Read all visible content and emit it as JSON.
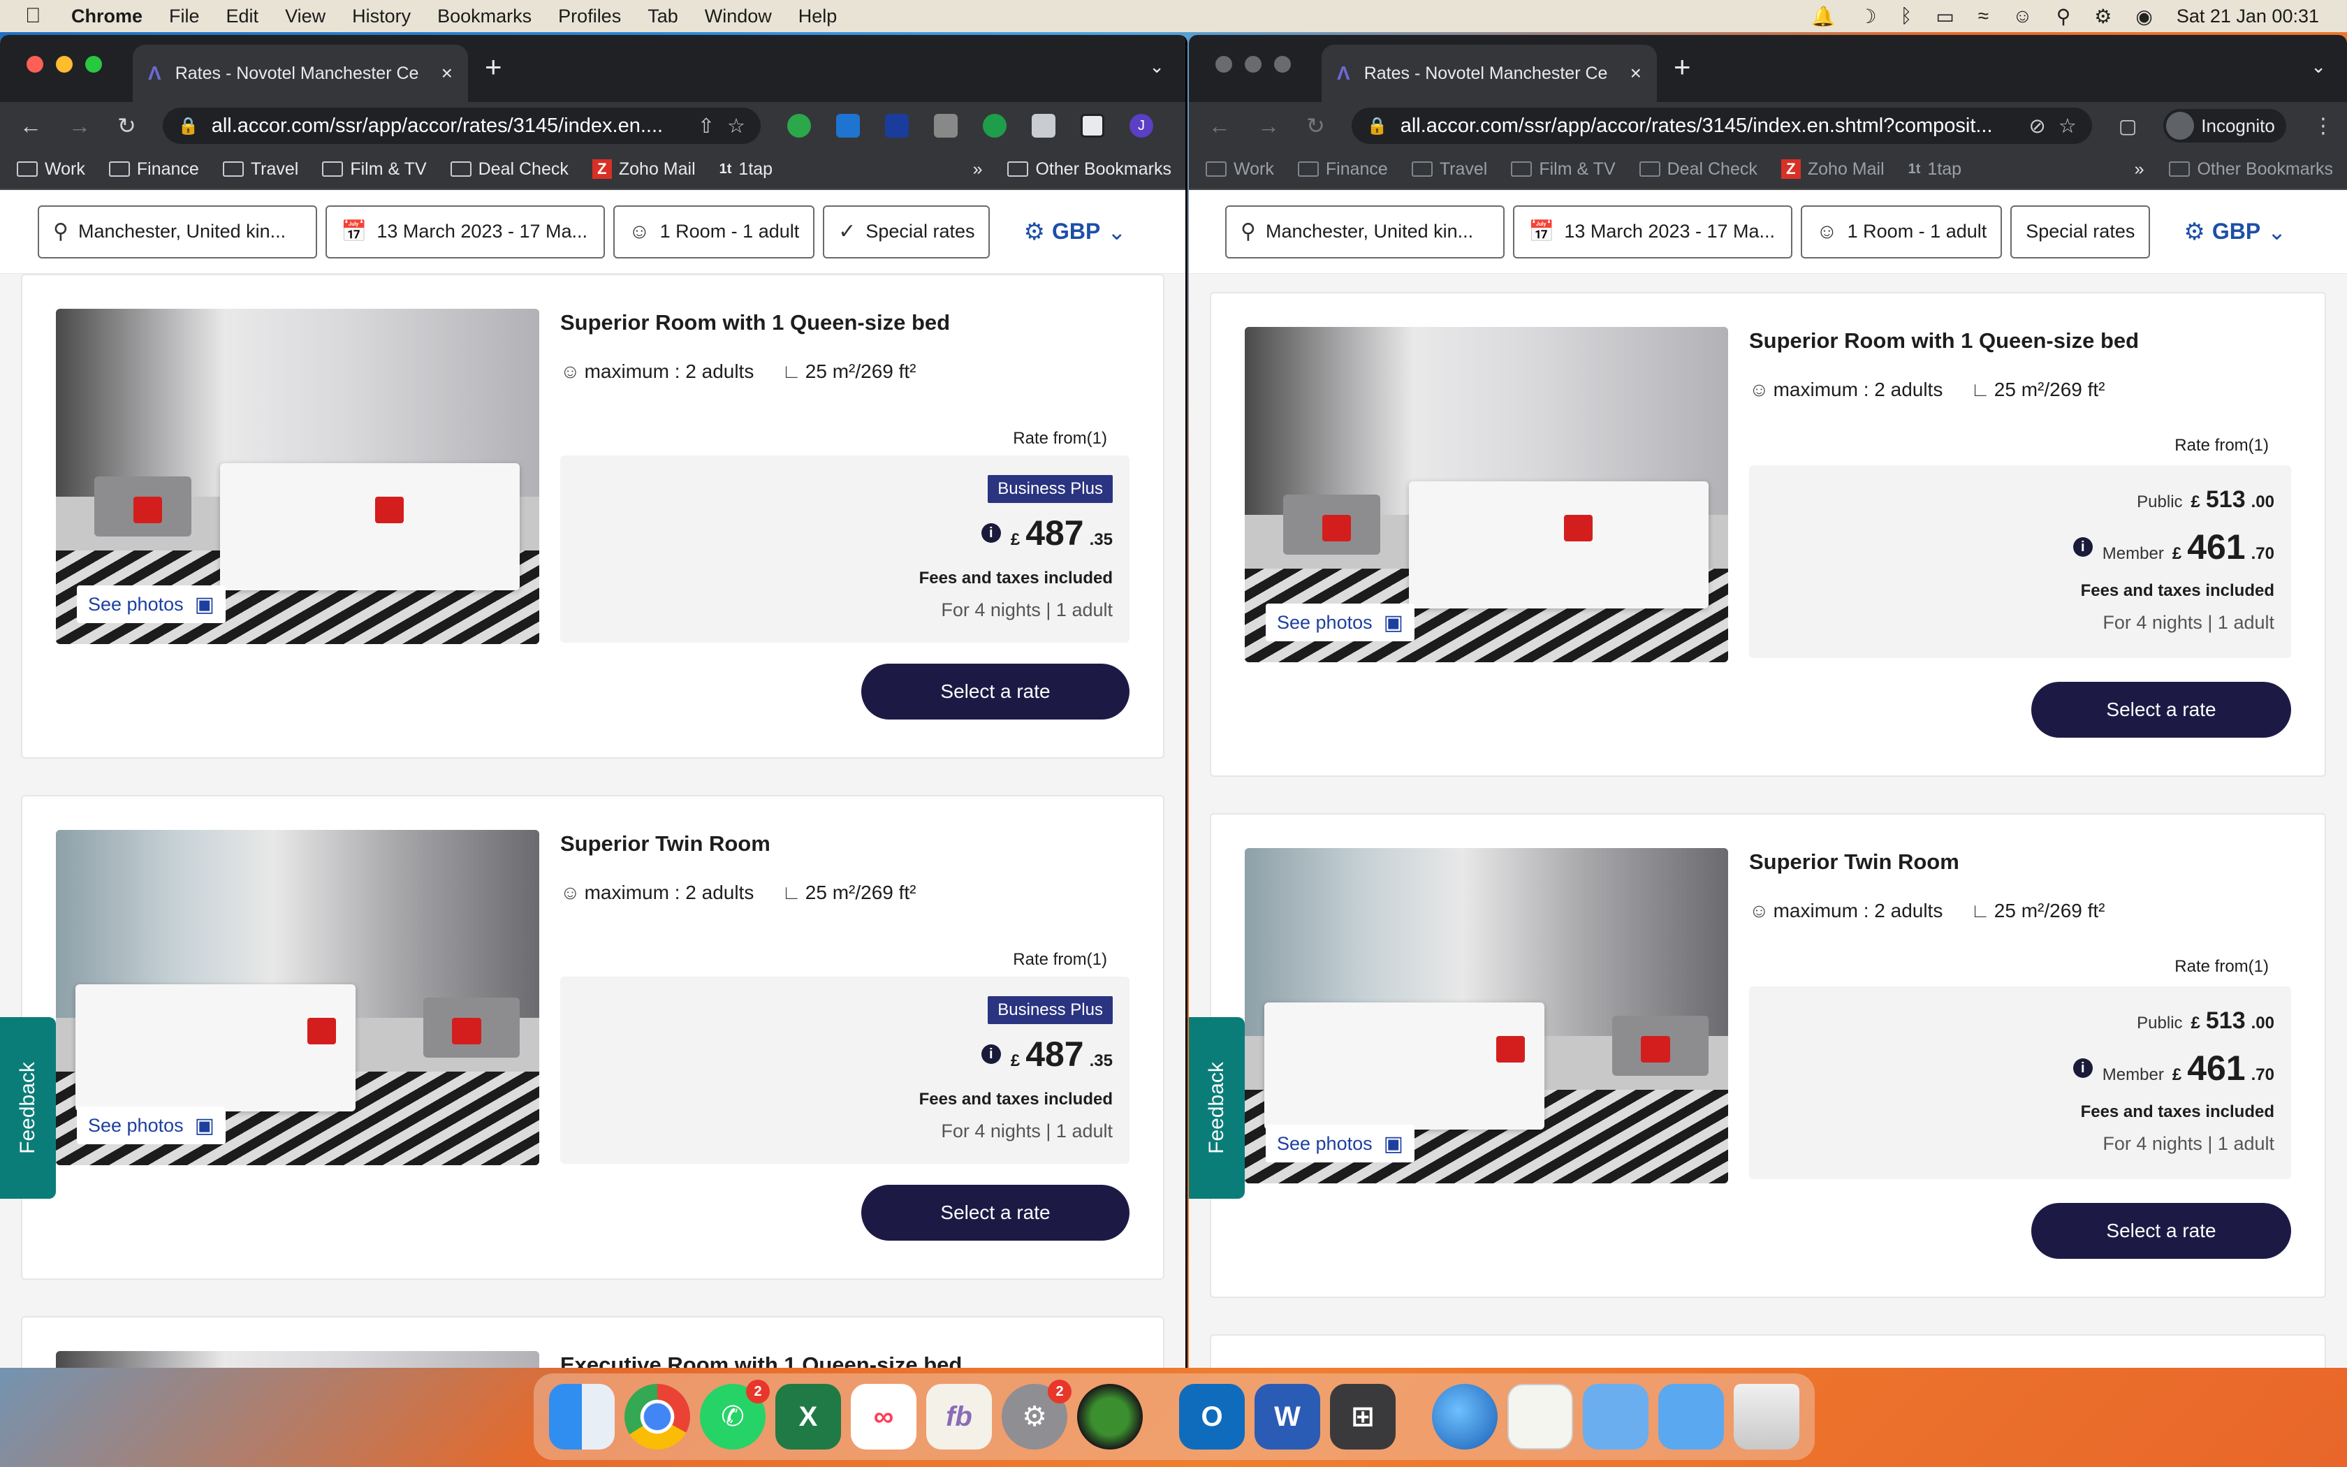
{
  "menubar": {
    "apple": "",
    "app": "Chrome",
    "items": [
      "File",
      "Edit",
      "View",
      "History",
      "Bookmarks",
      "Profiles",
      "Tab",
      "Window",
      "Help"
    ],
    "clock": "Sat 21 Jan  00:31"
  },
  "left": {
    "tab_title": "Rates - Novotel Manchester Ce",
    "url": "all.accor.com/ssr/app/accor/rates/3145/index.en....",
    "bookmarks": [
      "Work",
      "Finance",
      "Travel",
      "Film & TV",
      "Deal Check",
      "Zoho Mail",
      "1tap"
    ],
    "other_bookmarks": "Other Bookmarks",
    "more": "»",
    "avatar": "J"
  },
  "right": {
    "tab_title": "Rates - Novotel Manchester Ce",
    "url": "all.accor.com/ssr/app/accor/rates/3145/index.en.shtml?composit...",
    "incognito": "Incognito",
    "bookmarks": [
      "Work",
      "Finance",
      "Travel",
      "Film & TV",
      "Deal Check",
      "Zoho Mail",
      "1tap"
    ],
    "other_bookmarks": "Other Bookmarks",
    "more": "»"
  },
  "filters": {
    "location": "Manchester, United kin...",
    "dates": "13 March 2023 - 17 Ma...",
    "guests": "1 Room - 1 adult",
    "special": "Special rates",
    "currency": "GBP"
  },
  "common": {
    "see_photos": "See photos",
    "rate_from": "Rate from(1)",
    "fees": "Fees and taxes included",
    "nights": "For 4 nights | 1 adult",
    "select": "Select a rate",
    "max": "maximum : 2 adults",
    "size": "25 m²/269 ft²",
    "feedback": "Feedback"
  },
  "rooms": [
    {
      "name": "Superior Room with 1 Queen-size bed"
    },
    {
      "name": "Superior Twin Room"
    },
    {
      "name": "Executive Room with 1 Queen-size bed"
    }
  ],
  "left_price": {
    "badge": "Business Plus",
    "currency": "£",
    "whole": "487",
    "decimal": ".35"
  },
  "right_price": {
    "public_label": "Public",
    "public_currency": "£",
    "public_whole": "513",
    "public_decimal": ".00",
    "member_label": "Member",
    "member_currency": "£",
    "member_whole": "461",
    "member_decimal": ".70"
  },
  "dock": {
    "whatsapp_badge": "2",
    "settings_badge": "2"
  }
}
